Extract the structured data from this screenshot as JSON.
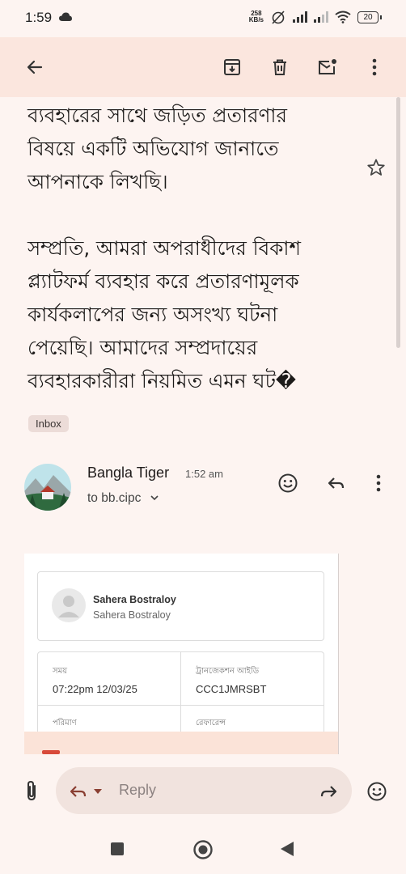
{
  "status": {
    "time": "1:59",
    "net_speed_top": "258",
    "net_speed_bottom": "KB/s",
    "battery": "20"
  },
  "toolbar": {
    "back_icon": "arrow-left-icon",
    "archive_icon": "archive-icon",
    "delete_icon": "trash-icon",
    "mark_unread_icon": "mail-unread-icon",
    "more_icon": "more-vert-icon"
  },
  "email": {
    "body": "ব্যবহারের সাথে জড়িত প্রতারণার\nবিষয়ে একটি অভিযোগ জানাতে\nআপনাকে লিখছি।\n\nসম্প্রতি, আমরা অপরাধীদের বিকাশ\nপ্ল্যাটফর্ম ব্যবহার করে প্রতারণামূলক\nকার্যকলাপের জন্য অসংখ্য ঘটনা\nপেয়েছি। আমাদের সম্প্রদায়ের\nব্যবহারকারীরা নিয়মিত এমন ঘট�",
    "label": "Inbox"
  },
  "message": {
    "sender": "Bangla Tiger",
    "time": "1:52 am",
    "to": "to bb.cipc"
  },
  "receipt": {
    "profile_name": "Sahera Bostraloy",
    "profile_sub": "Sahera Bostraloy",
    "time_label": "সময়",
    "time_value": "07:22pm 12/03/25",
    "txn_label": "ট্রানজেকশন আইডি",
    "txn_value": "CCC1JMRSBT",
    "amount_label": "পরিমাণ",
    "ref_label": "রেফারেন্স"
  },
  "reply": {
    "placeholder": "Reply"
  },
  "colors": {
    "toolbar_bg": "#fbe6de",
    "page_bg": "#fdf4f1",
    "pill_bg": "#f1e3de"
  }
}
